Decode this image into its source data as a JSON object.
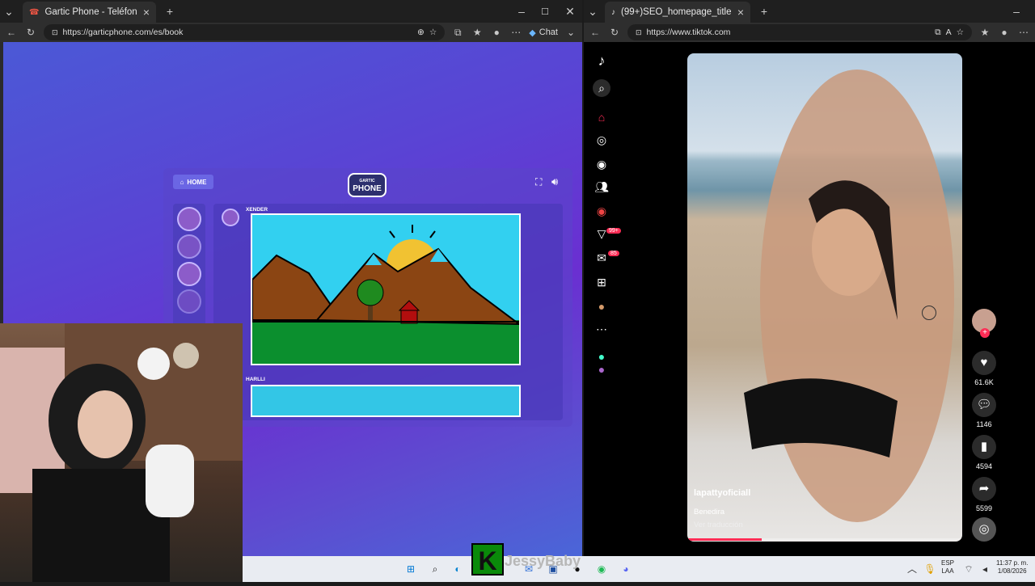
{
  "left_browser": {
    "tab_title": "Gartic Phone - Teléfono Descomp",
    "url": "https://garticphone.com/es/book",
    "chat_label": "Chat"
  },
  "right_browser": {
    "tab_title": "(99+)SEO_homepage_title",
    "url": "https://www.tiktok.com"
  },
  "gartic": {
    "home_label": "HOME",
    "logo_top": "GARTIC",
    "logo_main": "PHONE",
    "entries": [
      {
        "user": "XENDER"
      },
      {
        "user": "HARLLI"
      }
    ]
  },
  "tiktok": {
    "nav_badges": {
      "notifications": "99+",
      "messages": "85"
    },
    "video": {
      "username": "lapattyoficiall",
      "caption": "Benedira",
      "translate": "Ver traducción"
    },
    "actions": {
      "likes": "61.6K",
      "comments": "1146",
      "saves": "4594",
      "shares": "5599"
    }
  },
  "stream_overlay": {
    "streamer_name": "JessyBaby"
  },
  "taskbar": {
    "lang_top": "ESP",
    "lang_bottom": "LAA",
    "time": "11:37 p. m.",
    "date": "1/08/2026"
  },
  "colors": {
    "tiktok_red": "#fe2c55",
    "gartic_accent": "#6b66e4"
  }
}
